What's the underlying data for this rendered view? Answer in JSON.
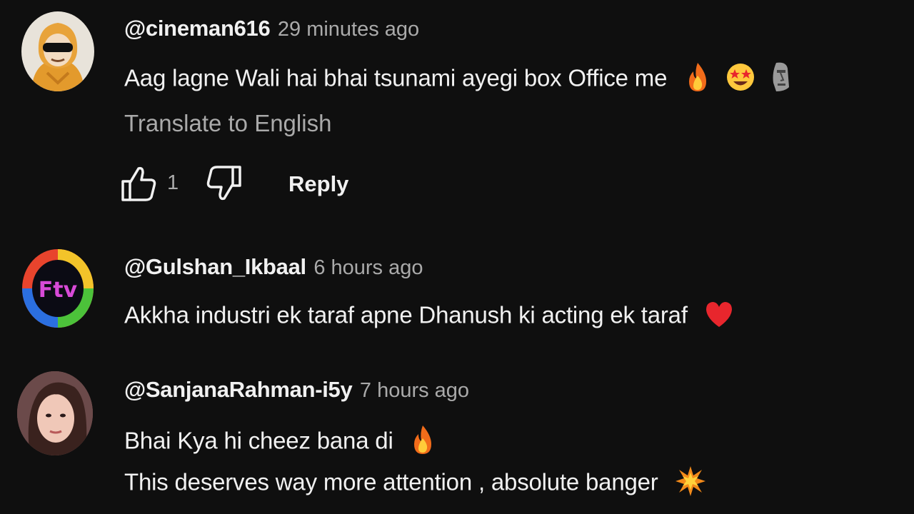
{
  "comments": [
    {
      "author": "@cineman616",
      "time": "29 minutes ago",
      "lines": [
        "Aag lagne Wali hai bhai tsunami ayegi box Office me"
      ],
      "emojis": [
        "fire-emoji",
        "star-struck-emoji",
        "moai-emoji"
      ],
      "translate_label": "Translate to English",
      "like_count": "1",
      "reply_label": "Reply"
    },
    {
      "author": "@Gulshan_Ikbaal",
      "time": "6 hours ago",
      "avatar_text": "Ftv",
      "lines": [
        "Akkha industri ek taraf apne Dhanush ki acting ek taraf"
      ],
      "emojis": [
        "red-heart-emoji"
      ]
    },
    {
      "author": "@SanjanaRahman-i5y",
      "time": "7 hours ago",
      "lines": [
        "Bhai Kya hi cheez bana di",
        "This deserves way more attention , absolute banger"
      ],
      "emojis": [
        "fire-emoji",
        "collision-emoji"
      ]
    }
  ],
  "colors": {
    "background": "#0f0f0f",
    "primary_text": "#f1f1f1",
    "secondary_text": "#aaaaaa"
  }
}
